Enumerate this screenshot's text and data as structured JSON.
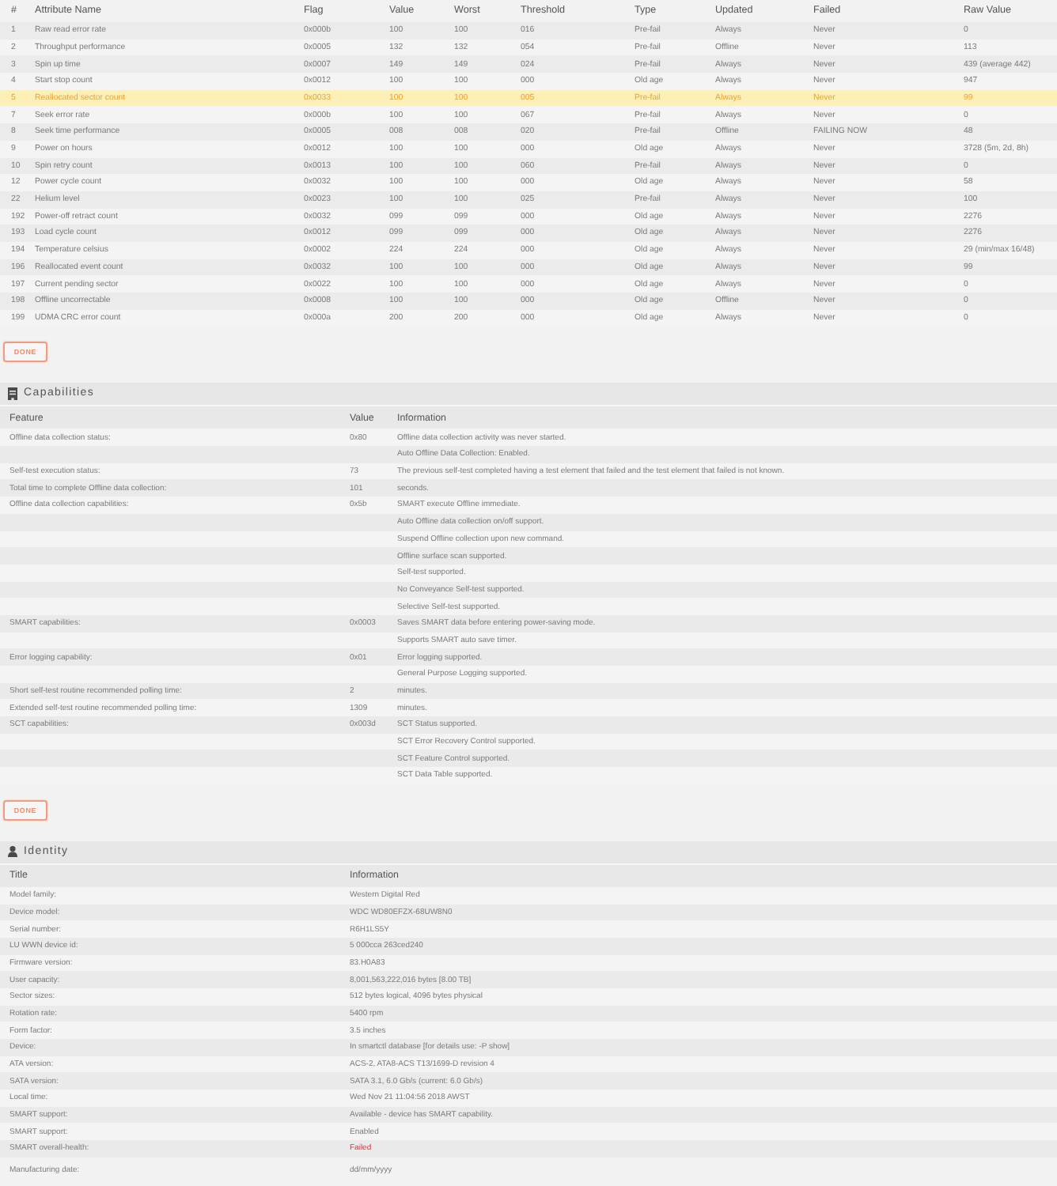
{
  "attributes": {
    "columns": [
      "#",
      "Attribute Name",
      "Flag",
      "Value",
      "Worst",
      "Threshold",
      "Type",
      "Updated",
      "Failed",
      "Raw Value"
    ],
    "rows": [
      {
        "id": "1",
        "name": "Raw read error rate",
        "flag": "0x000b",
        "value": "100",
        "worst": "100",
        "threshold": "016",
        "type": "Pre-fail",
        "updated": "Always",
        "failed": "Never",
        "raw_value": "0",
        "warning": false
      },
      {
        "id": "2",
        "name": "Throughput performance",
        "flag": "0x0005",
        "value": "132",
        "worst": "132",
        "threshold": "054",
        "type": "Pre-fail",
        "updated": "Offline",
        "failed": "Never",
        "raw_value": "113",
        "warning": false
      },
      {
        "id": "3",
        "name": "Spin up time",
        "flag": "0x0007",
        "value": "149",
        "worst": "149",
        "threshold": "024",
        "type": "Pre-fail",
        "updated": "Always",
        "failed": "Never",
        "raw_value": "439 (average 442)",
        "warning": false
      },
      {
        "id": "4",
        "name": "Start stop count",
        "flag": "0x0012",
        "value": "100",
        "worst": "100",
        "threshold": "000",
        "type": "Old age",
        "updated": "Always",
        "failed": "Never",
        "raw_value": "947",
        "warning": false
      },
      {
        "id": "5",
        "name": "Reallocated sector count",
        "flag": "0x0033",
        "value": "100",
        "worst": "100",
        "threshold": "005",
        "type": "Pre-fail",
        "updated": "Always",
        "failed": "Never",
        "raw_value": "99",
        "warning": true
      },
      {
        "id": "7",
        "name": "Seek error rate",
        "flag": "0x000b",
        "value": "100",
        "worst": "100",
        "threshold": "067",
        "type": "Pre-fail",
        "updated": "Always",
        "failed": "Never",
        "raw_value": "0",
        "warning": false
      },
      {
        "id": "8",
        "name": "Seek time performance",
        "flag": "0x0005",
        "value": "008",
        "worst": "008",
        "threshold": "020",
        "type": "Pre-fail",
        "updated": "Offline",
        "failed": "FAILING NOW",
        "raw_value": "48",
        "warning": false
      },
      {
        "id": "9",
        "name": "Power on hours",
        "flag": "0x0012",
        "value": "100",
        "worst": "100",
        "threshold": "000",
        "type": "Old age",
        "updated": "Always",
        "failed": "Never",
        "raw_value": "3728 (5m, 2d, 8h)",
        "warning": false
      },
      {
        "id": "10",
        "name": "Spin retry count",
        "flag": "0x0013",
        "value": "100",
        "worst": "100",
        "threshold": "060",
        "type": "Pre-fail",
        "updated": "Always",
        "failed": "Never",
        "raw_value": "0",
        "warning": false
      },
      {
        "id": "12",
        "name": "Power cycle count",
        "flag": "0x0032",
        "value": "100",
        "worst": "100",
        "threshold": "000",
        "type": "Old age",
        "updated": "Always",
        "failed": "Never",
        "raw_value": "58",
        "warning": false
      },
      {
        "id": "22",
        "name": "Helium level",
        "flag": "0x0023",
        "value": "100",
        "worst": "100",
        "threshold": "025",
        "type": "Pre-fail",
        "updated": "Always",
        "failed": "Never",
        "raw_value": "100",
        "warning": false
      },
      {
        "id": "192",
        "name": "Power-off retract count",
        "flag": "0x0032",
        "value": "099",
        "worst": "099",
        "threshold": "000",
        "type": "Old age",
        "updated": "Always",
        "failed": "Never",
        "raw_value": "2276",
        "warning": false
      },
      {
        "id": "193",
        "name": "Load cycle count",
        "flag": "0x0012",
        "value": "099",
        "worst": "099",
        "threshold": "000",
        "type": "Old age",
        "updated": "Always",
        "failed": "Never",
        "raw_value": "2276",
        "warning": false
      },
      {
        "id": "194",
        "name": "Temperature celsius",
        "flag": "0x0002",
        "value": "224",
        "worst": "224",
        "threshold": "000",
        "type": "Old age",
        "updated": "Always",
        "failed": "Never",
        "raw_value": "29 (min/max 16/48)",
        "warning": false
      },
      {
        "id": "196",
        "name": "Reallocated event count",
        "flag": "0x0032",
        "value": "100",
        "worst": "100",
        "threshold": "000",
        "type": "Old age",
        "updated": "Always",
        "failed": "Never",
        "raw_value": "99",
        "warning": false
      },
      {
        "id": "197",
        "name": "Current pending sector",
        "flag": "0x0022",
        "value": "100",
        "worst": "100",
        "threshold": "000",
        "type": "Old age",
        "updated": "Always",
        "failed": "Never",
        "raw_value": "0",
        "warning": false
      },
      {
        "id": "198",
        "name": "Offline uncorrectable",
        "flag": "0x0008",
        "value": "100",
        "worst": "100",
        "threshold": "000",
        "type": "Old age",
        "updated": "Offline",
        "failed": "Never",
        "raw_value": "0",
        "warning": false
      },
      {
        "id": "199",
        "name": "UDMA CRC error count",
        "flag": "0x000a",
        "value": "200",
        "worst": "200",
        "threshold": "000",
        "type": "Old age",
        "updated": "Always",
        "failed": "Never",
        "raw_value": "0",
        "warning": false
      }
    ],
    "button": "DONE"
  },
  "capabilities": {
    "title": "Capabilities",
    "columns": [
      "Feature",
      "Value",
      "Information"
    ],
    "rows": [
      {
        "feature": "Offline data collection status:",
        "value": "0x80",
        "information": "Offline data collection activity was never started."
      },
      {
        "information": "Auto Offline Data Collection: Enabled."
      },
      {
        "feature": "Self-test execution status:",
        "value": "73",
        "information": "The previous self-test completed having a test element that failed and the test element that failed is not known."
      },
      {
        "feature": "Total time to complete Offline data collection:",
        "value": "101",
        "information": "seconds."
      },
      {
        "feature": "Offline data collection capabilities:",
        "value": "0x5b",
        "information": "SMART execute Offline immediate."
      },
      {
        "information": "Auto Offline data collection on/off support."
      },
      {
        "information": "Suspend Offline collection upon new command."
      },
      {
        "information": "Offline surface scan supported."
      },
      {
        "information": "Self-test supported."
      },
      {
        "information": "No Conveyance Self-test supported."
      },
      {
        "information": "Selective Self-test supported."
      },
      {
        "feature": "SMART capabilities:",
        "value": "0x0003",
        "information": "Saves SMART data before entering power-saving mode."
      },
      {
        "information": "Supports SMART auto save timer."
      },
      {
        "feature": "Error logging capability:",
        "value": "0x01",
        "information": "Error logging supported."
      },
      {
        "information": "General Purpose Logging supported."
      },
      {
        "feature": "Short self-test routine recommended polling time:",
        "value": "2",
        "information": "minutes."
      },
      {
        "feature": "Extended self-test routine recommended polling time:",
        "value": "1309",
        "information": "minutes."
      },
      {
        "feature": "SCT capabilities:",
        "value": "0x003d",
        "information": "SCT Status supported."
      },
      {
        "information": "SCT Error Recovery Control supported."
      },
      {
        "information": "SCT Feature Control supported."
      },
      {
        "information": "SCT Data Table supported."
      }
    ],
    "button": "DONE"
  },
  "identity": {
    "title": "Identity",
    "columns": [
      "Title",
      "Information"
    ],
    "rows": [
      {
        "title": "Model family:",
        "information": "Western Digital Red",
        "alert": false
      },
      {
        "title": "Device model:",
        "information": "WDC WD80EFZX-68UW8N0",
        "alert": false
      },
      {
        "title": "Serial number:",
        "information": "R6H1LS5Y",
        "alert": false
      },
      {
        "title": "LU WWN device id:",
        "information": "5 000cca 263ced240",
        "alert": false
      },
      {
        "title": "Firmware version:",
        "information": "83.H0A83",
        "alert": false
      },
      {
        "title": "User capacity:",
        "information": "8,001,563,222,016 bytes [8.00 TB]",
        "alert": false
      },
      {
        "title": "Sector sizes:",
        "information": "512 bytes logical, 4096 bytes physical",
        "alert": false
      },
      {
        "title": "Rotation rate:",
        "information": "5400 rpm",
        "alert": false
      },
      {
        "title": "Form factor:",
        "information": "3.5 inches",
        "alert": false
      },
      {
        "title": "Device:",
        "information": "In smartctl database [for details use: -P show]",
        "alert": false
      },
      {
        "title": "ATA version:",
        "information": "ACS-2, ATA8-ACS T13/1699-D revision 4",
        "alert": false
      },
      {
        "title": "SATA version:",
        "information": "SATA 3.1, 6.0 Gb/s (current: 6.0 Gb/s)",
        "alert": false
      },
      {
        "title": "Local time:",
        "information": "Wed Nov 21 11:04:56 2018 AWST",
        "alert": false
      },
      {
        "title": "SMART support:",
        "information": "Available - device has SMART capability.",
        "alert": false
      },
      {
        "title": "SMART support:",
        "information": "Enabled",
        "alert": false
      },
      {
        "title": "SMART overall-health:",
        "information": "Failed",
        "alert": true
      },
      {
        "title": "Manufacturing date:",
        "information": "dd/mm/yyyy",
        "alert": false
      }
    ]
  }
}
